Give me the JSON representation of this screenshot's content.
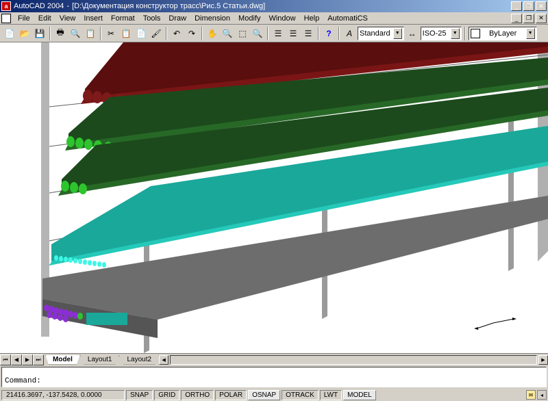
{
  "title": {
    "app": "AutoCAD 2004",
    "sep": " - ",
    "doc": "[D:\\Документация конструктор трасс\\Рис.5 Статьи.dwg]",
    "icon_char": "a"
  },
  "menu": {
    "items": [
      "File",
      "Edit",
      "View",
      "Insert",
      "Format",
      "Tools",
      "Draw",
      "Dimension",
      "Modify",
      "Window",
      "Help",
      "AutomatiCS"
    ]
  },
  "toolbar": {
    "style_combo": "Standard",
    "dimstyle_combo": "ISO-25",
    "layer_combo": "ByLayer"
  },
  "tabs": {
    "model": "Model",
    "layout1": "Layout1",
    "layout2": "Layout2"
  },
  "command": {
    "prompt": "Command:"
  },
  "status": {
    "coords": "21416.3697, -137.5428, 0.0000",
    "snap": "SNAP",
    "grid": "GRID",
    "ortho": "ORTHO",
    "polar": "POLAR",
    "osnap": "OSNAP",
    "otrack": "OTRACK",
    "lwt": "LWT",
    "model": "MODEL"
  }
}
